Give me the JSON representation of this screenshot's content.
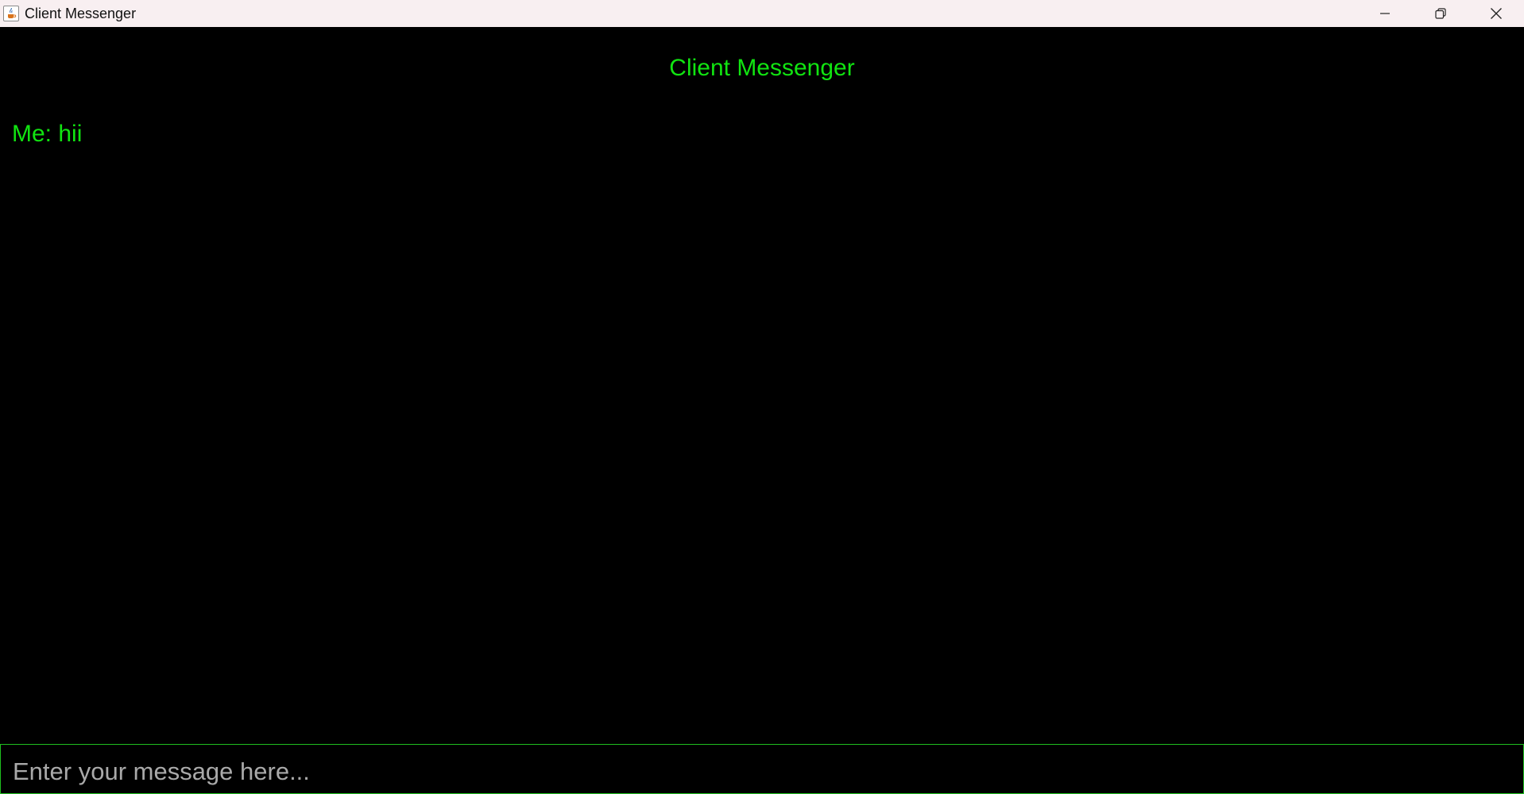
{
  "window": {
    "title": "Client Messenger",
    "icon": "java-cup-icon",
    "controls": [
      "minimize-icon",
      "restore-icon",
      "close-icon"
    ]
  },
  "app": {
    "heading": "Client Messenger",
    "messages": [
      {
        "text": "Me: hii"
      }
    ],
    "input": {
      "placeholder": "Enter your message here...",
      "value": ""
    }
  },
  "colors": {
    "background": "#000000",
    "text": "#11e411",
    "input_border": "#1fbf1f",
    "titlebar": "#f8eff1",
    "placeholder": "#a9a9a9"
  }
}
